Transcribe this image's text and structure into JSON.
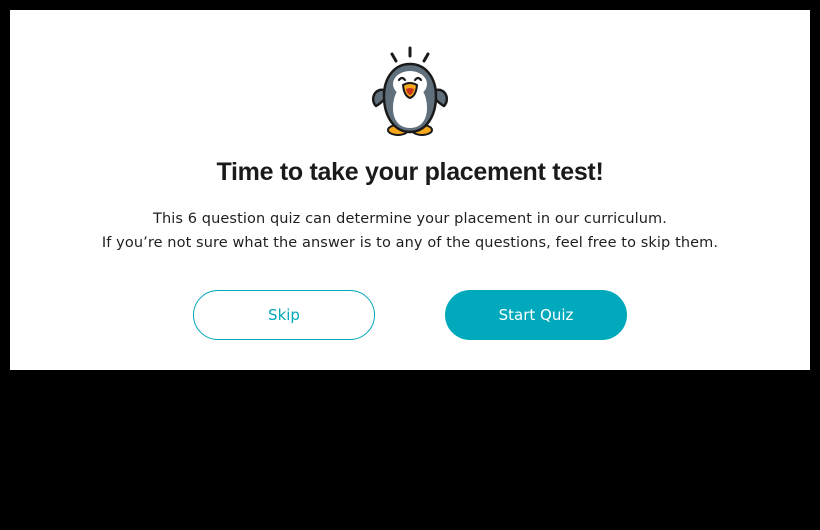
{
  "dialog": {
    "mascot_icon": "cheering-penguin-icon",
    "title": "Time to take your placement test!",
    "description_line1": "This 6 question quiz can determine your placement in our curriculum.",
    "description_line2": "If you’re not sure what the answer is to any of the questions, feel free to skip them.",
    "skip_label": "Skip",
    "start_label": "Start Quiz"
  },
  "colors": {
    "accent": "#00a9bb",
    "background": "#000000",
    "dialog": "#ffffff"
  }
}
